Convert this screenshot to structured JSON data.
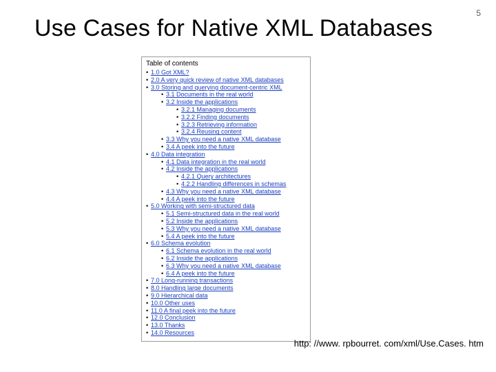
{
  "page": {
    "number": "5",
    "title": "Use Cases for Native XML Databases",
    "source_url": "http: //www. rpbourret. com/xml/Use.Cases. htm"
  },
  "toc": {
    "heading": "Table of contents",
    "bullet": "•",
    "items": [
      {
        "level": 0,
        "text": "1.0 Got XML?"
      },
      {
        "level": 0,
        "text": "2.0 A very quick review of native XML databases"
      },
      {
        "level": 0,
        "text": "3.0 Storing and querying document-centric XML"
      },
      {
        "level": 1,
        "text": "3.1 Documents in the real world"
      },
      {
        "level": 1,
        "text": "3.2 Inside the applications"
      },
      {
        "level": 2,
        "text": "3.2.1 Managing documents"
      },
      {
        "level": 2,
        "text": "3.2.2 Finding documents"
      },
      {
        "level": 2,
        "text": "3.2.3 Retrieving information"
      },
      {
        "level": 2,
        "text": "3.2.4 Reusing content"
      },
      {
        "level": 1,
        "text": "3.3 Why you need a native XML database"
      },
      {
        "level": 1,
        "text": "3.4 A peek into the future"
      },
      {
        "level": 0,
        "text": "4.0 Data integration"
      },
      {
        "level": 1,
        "text": "4.1 Data integration in the real world"
      },
      {
        "level": 1,
        "text": "4.2 Inside the applications"
      },
      {
        "level": 2,
        "text": "4.2.1 Query architectures"
      },
      {
        "level": 2,
        "text": "4.2.2 Handling differences in schemas"
      },
      {
        "level": 1,
        "text": "4.3 Why you need a native XML database"
      },
      {
        "level": 1,
        "text": "4.4 A peek into the future"
      },
      {
        "level": 0,
        "text": "5.0 Working with semi-structured data"
      },
      {
        "level": 1,
        "text": "5.1 Semi-structured data in the real world"
      },
      {
        "level": 1,
        "text": "5.2 Inside the applications"
      },
      {
        "level": 1,
        "text": "5.3 Why you need a native XML database"
      },
      {
        "level": 1,
        "text": "5.4 A peek into the future"
      },
      {
        "level": 0,
        "text": "6.0 Schema evolution"
      },
      {
        "level": 1,
        "text": "6.1 Schema evolution in the real world"
      },
      {
        "level": 1,
        "text": "6.2 Inside the applications"
      },
      {
        "level": 1,
        "text": "6.3 Why you need a native XML database"
      },
      {
        "level": 1,
        "text": "6.4 A peek into the future"
      },
      {
        "level": 0,
        "text": "7.0 Long-running transactions"
      },
      {
        "level": 0,
        "text": "8.0 Handling large documents"
      },
      {
        "level": 0,
        "text": "9.0 Hierarchical data"
      },
      {
        "level": 0,
        "text": "10.0 Other uses"
      },
      {
        "level": 0,
        "text": "11.0 A final peek into the future"
      },
      {
        "level": 0,
        "text": "12.0 Conclusion"
      },
      {
        "level": 0,
        "text": "13.0 Thanks"
      },
      {
        "level": 0,
        "text": "14.0 Resources"
      }
    ]
  }
}
